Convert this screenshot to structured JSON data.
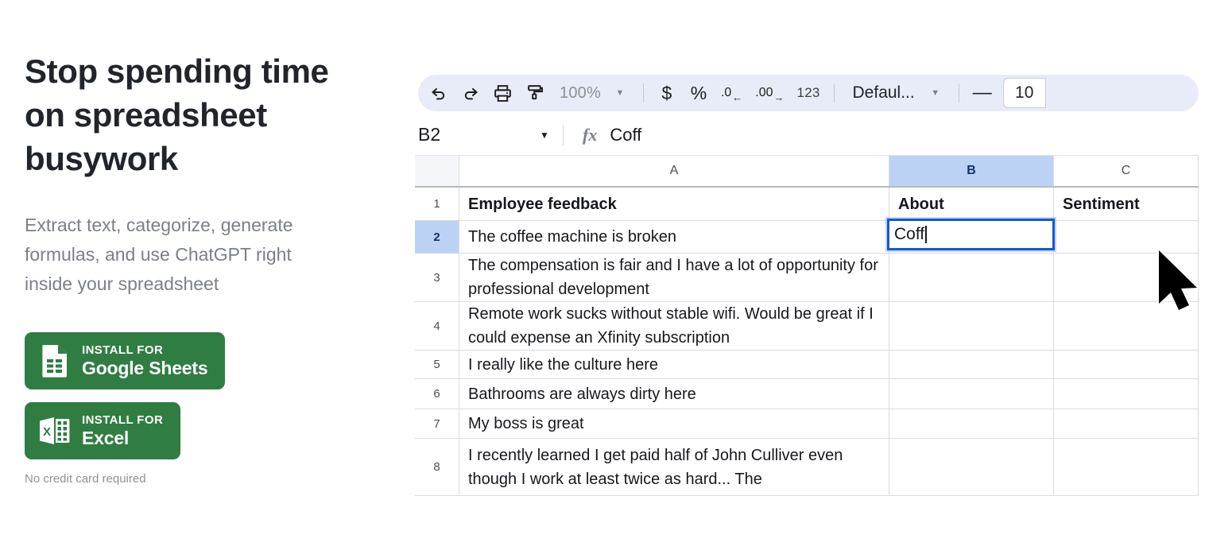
{
  "marketing": {
    "headline": "Stop spending time on spreadsheet busywork",
    "subhead": "Extract text, categorize, generate formulas, and use ChatGPT right inside your spreadsheet",
    "buttons": [
      {
        "kicker": "INSTALL FOR",
        "label": "Google Sheets",
        "icon": "google-sheets-icon",
        "color": "#2f7d42"
      },
      {
        "kicker": "INSTALL FOR",
        "label": "Excel",
        "icon": "excel-icon",
        "color": "#2f7d42"
      }
    ],
    "fineprint": "No credit card required"
  },
  "spreadsheet": {
    "toolbar": {
      "undo": "undo-icon",
      "redo": "redo-icon",
      "print": "print-icon",
      "paint_format": "paint-format-icon",
      "zoom_value": "100%",
      "zoom_caret": "▼",
      "currency": "$",
      "percent": "%",
      "decrease_decimal": ".0",
      "increase_decimal": ".00",
      "more_formats": "123",
      "font_family": "Defaul...",
      "font_caret": "▼",
      "font_size_decrease": "—",
      "font_size_value": "10"
    },
    "formula_bar": {
      "name_box": "B2",
      "name_box_caret": "▼",
      "fx_label": "fx",
      "value": "Coff"
    },
    "columns": [
      {
        "label": "A",
        "selected": false
      },
      {
        "label": "B",
        "selected": true
      },
      {
        "label": "C",
        "selected": false
      }
    ],
    "rows": [
      {
        "num": "1",
        "selected": false,
        "a": "Employee feedback",
        "b": "About",
        "c": "Sentiment",
        "bold": true
      },
      {
        "num": "2",
        "selected": true,
        "a": "The coffee machine is broken",
        "b": "",
        "c": "",
        "bold": false,
        "editing": true,
        "editing_text": "Coff"
      },
      {
        "num": "3",
        "selected": false,
        "a": "The compensation is fair and I have a lot of opportunity for professional development",
        "b": "",
        "c": "",
        "bold": false
      },
      {
        "num": "4",
        "selected": false,
        "a": "Remote work sucks without stable wifi. Would be great if I could expense an Xfinity subscription",
        "b": "",
        "c": "",
        "bold": false
      },
      {
        "num": "5",
        "selected": false,
        "a": "I really like the culture here",
        "b": "",
        "c": "",
        "bold": false
      },
      {
        "num": "6",
        "selected": false,
        "a": "Bathrooms are always dirty here",
        "b": "",
        "c": "",
        "bold": false
      },
      {
        "num": "7",
        "selected": false,
        "a": "My boss is great",
        "b": "",
        "c": "",
        "bold": false
      },
      {
        "num": "8",
        "selected": false,
        "a": "I recently learned I get paid half of John Culliver even though I work at least twice as hard...  The",
        "b": "",
        "c": "",
        "bold": false
      }
    ]
  },
  "cursor": {
    "icon": "mouse-pointer-icon"
  }
}
